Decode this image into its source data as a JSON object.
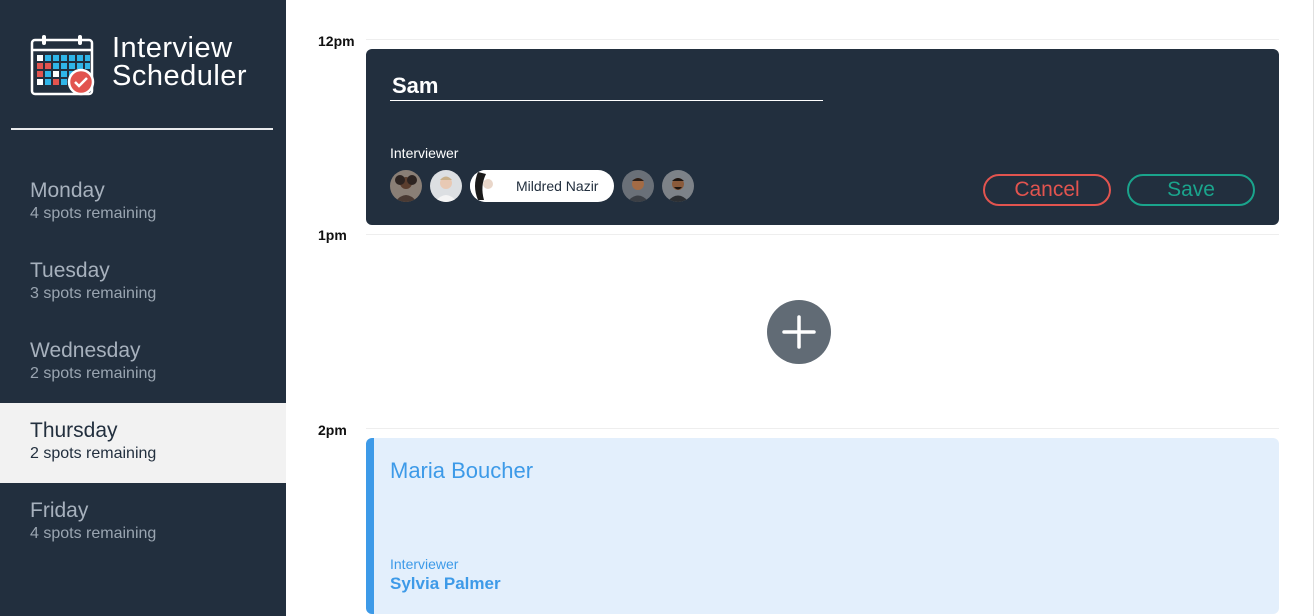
{
  "app": {
    "title_line1": "Interview",
    "title_line2": "Scheduler",
    "accent_color": "#222f3e"
  },
  "sidebar": {
    "days": [
      {
        "name": "Monday",
        "spots": "4 spots remaining",
        "selected": false
      },
      {
        "name": "Tuesday",
        "spots": "3 spots remaining",
        "selected": false
      },
      {
        "name": "Wednesday",
        "spots": "2 spots remaining",
        "selected": false
      },
      {
        "name": "Thursday",
        "spots": "2 spots remaining",
        "selected": true
      },
      {
        "name": "Friday",
        "spots": "4 spots remaining",
        "selected": false
      }
    ]
  },
  "schedule": {
    "times": [
      "12pm",
      "1pm",
      "2pm"
    ],
    "form": {
      "student_value": "Sam",
      "interviewer_label": "Interviewer",
      "selected_interviewer": "Mildred Nazir",
      "cancel_label": "Cancel",
      "save_label": "Save",
      "cancel_color": "#e2544f",
      "save_color": "#1aa48c"
    },
    "add_icon": "plus-icon",
    "booked": {
      "student": "Maria Boucher",
      "interviewer_label": "Interviewer",
      "interviewer": "Sylvia Palmer",
      "color": "#3d9ae8"
    }
  }
}
